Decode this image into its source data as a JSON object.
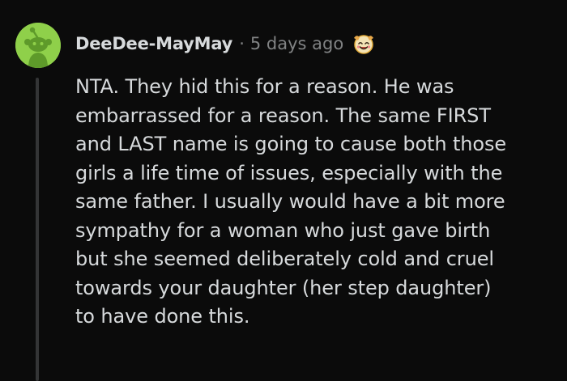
{
  "comment": {
    "username": "DeeDee-MayMay",
    "separator": "·",
    "timestamp": "5 days ago",
    "avatar_icon": "snoo-avatar-icon",
    "award_icon": "wholesome-award-icon",
    "body_lines": [
      "NTA. They hid this for a reason. He was",
      "embarrassed for a reason. The same FIRST",
      "and LAST name is going to cause both those",
      "girls a life time of issues, especially with the",
      "same father. I usually would have a bit more",
      "sympathy for a woman who just gave birth",
      "but she seemed deliberately cold and cruel",
      "towards your daughter (her step daughter)",
      "to have done this."
    ]
  },
  "colors": {
    "background": "#0b0b0b",
    "text": "#d7dadc",
    "meta": "#818384",
    "avatar_bg": "#8fd04a",
    "thread_line": "#343536"
  }
}
